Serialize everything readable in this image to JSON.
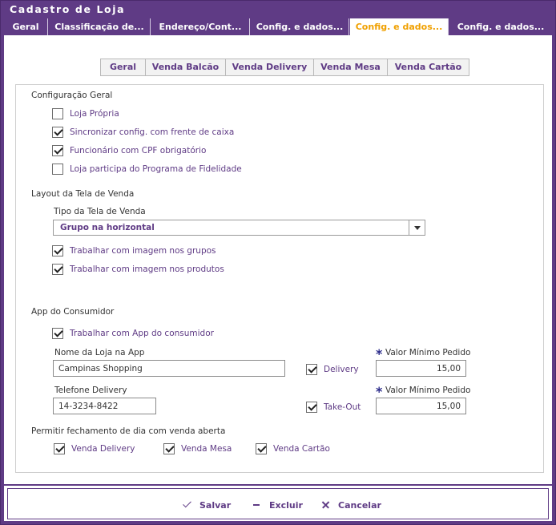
{
  "window": {
    "title": "Cadastro de Loja"
  },
  "tabs": [
    {
      "label": "Geral"
    },
    {
      "label": "Classificação de..."
    },
    {
      "label": "Endereço/Cont..."
    },
    {
      "label": "Config. e dados..."
    },
    {
      "label": "Config. e dados..."
    },
    {
      "label": "Config. e dados..."
    }
  ],
  "subtabs": [
    {
      "label": "Geral"
    },
    {
      "label": "Venda Balcão"
    },
    {
      "label": "Venda Delivery"
    },
    {
      "label": "Venda Mesa"
    },
    {
      "label": "Venda Cartão"
    }
  ],
  "config_geral": {
    "title": "Configuração Geral",
    "items": [
      {
        "label": "Loja Própria",
        "checked": false
      },
      {
        "label": "Sincronizar config. com frente de caixa",
        "checked": true
      },
      {
        "label": "Funcionário com CPF obrigatório",
        "checked": true
      },
      {
        "label": "Loja participa do Programa de Fidelidade",
        "checked": false
      }
    ]
  },
  "layout_tela": {
    "title": "Layout da Tela de Venda",
    "tipo_label": "Tipo da Tela de Venda",
    "tipo_value": "Grupo na horizontal",
    "items": [
      {
        "label": "Trabalhar com imagem nos grupos",
        "checked": true
      },
      {
        "label": "Trabalhar com imagem nos produtos",
        "checked": true
      }
    ]
  },
  "app_consumidor": {
    "title": "App do Consumidor",
    "trabalhar": {
      "label": "Trabalhar com App do consumidor",
      "checked": true
    },
    "nome_label": "Nome da Loja na App",
    "nome_value": "Campinas Shopping",
    "delivery": {
      "label": "Delivery",
      "checked": true
    },
    "valor_label_1": "Valor Mínimo Pedido",
    "valor_value_1": "15,00",
    "telefone_label": "Telefone Delivery",
    "telefone_value": "14-3234-8422",
    "takeout": {
      "label": "Take-Out",
      "checked": true
    },
    "valor_label_2": "Valor Mínimo Pedido",
    "valor_value_2": "15,00",
    "required_mark": "*"
  },
  "fechamento": {
    "title": "Permitir fechamento de dia com venda aberta",
    "items": [
      {
        "label": "Venda Delivery",
        "checked": true
      },
      {
        "label": "Venda Mesa",
        "checked": true
      },
      {
        "label": "Venda Cartão",
        "checked": true
      }
    ]
  },
  "footer": {
    "save": "Salvar",
    "delete": "Excluir",
    "cancel": "Cancelar"
  },
  "colors": {
    "brand": "#5f3b85",
    "active_tab_text": "#f0a000"
  }
}
